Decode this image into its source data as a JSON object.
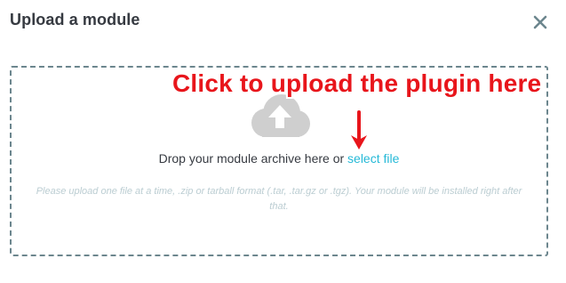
{
  "modal": {
    "title": "Upload a module"
  },
  "dropzone": {
    "drop_text": "Drop your module archive here or ",
    "select_link": "select file",
    "help_text": "Please upload one file at a time, .zip or tarball format (.tar, .tar.gz or .tgz). Your module will be installed right after that."
  },
  "annotation": {
    "text": "Click to upload the plugin here",
    "color": "#e8151b"
  },
  "icons": {
    "close": "close-icon",
    "cloud_upload": "cloud-upload-icon",
    "arrow": "arrow-down-icon"
  },
  "colors": {
    "link": "#25b9d7",
    "border": "#6c868e",
    "text": "#363a41",
    "muted": "#bbcdd2"
  }
}
